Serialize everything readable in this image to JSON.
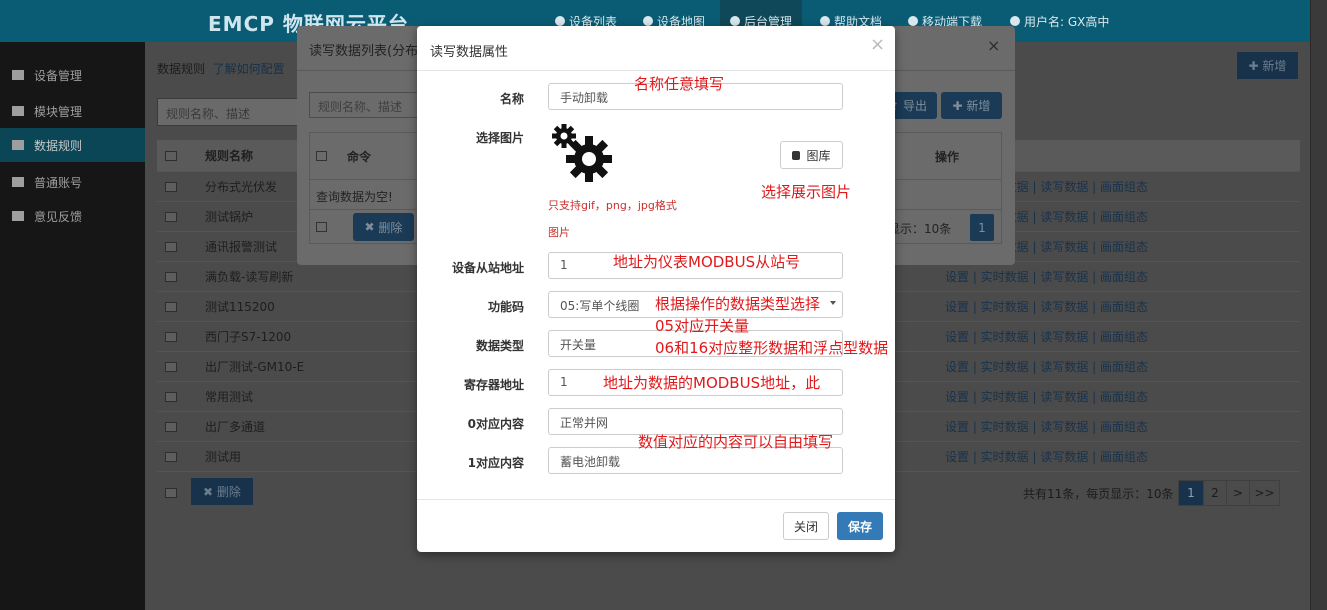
{
  "app": {
    "logo": "EMCP 物联网云平台"
  },
  "topnav": [
    {
      "label": "设备列表"
    },
    {
      "label": "设备地图"
    },
    {
      "label": "后台管理"
    },
    {
      "label": "帮助文档"
    },
    {
      "label": "移动端下载"
    },
    {
      "label": "用户名: GX高中"
    }
  ],
  "sidebar": {
    "items": [
      {
        "label": "设备管理"
      },
      {
        "label": "模块管理"
      },
      {
        "label": "数据规则"
      },
      {
        "label": "普通账号"
      },
      {
        "label": "意见反馈"
      }
    ]
  },
  "main": {
    "crumb_title": "数据规则",
    "crumb_link": "了解如何配置",
    "search_placeholder": "规则名称、描述",
    "new_button": "新增",
    "col_name": "规则名称",
    "rows": [
      {
        "name": "分布式光伏发"
      },
      {
        "name": "测试锅炉"
      },
      {
        "name": "通讯报警测试"
      },
      {
        "name": "满负载-读写刷新"
      },
      {
        "name": "测试115200"
      },
      {
        "name": "西门子S7-1200"
      },
      {
        "name": "出厂测试-GM10-E"
      },
      {
        "name": "常用测试"
      },
      {
        "name": "出厂多通道"
      },
      {
        "name": "测试用"
      }
    ],
    "ops": "设置 | 实时数据 | 读写数据 | 画面组态",
    "delete_button": "删除",
    "pagination_text": "共有11条，每页显示：10条",
    "pages": [
      "1",
      "2",
      ">",
      ">>"
    ]
  },
  "modal1": {
    "title": "读写数据列表(分布",
    "search_placeholder": "规则名称、描述",
    "export_button": "导出",
    "new_button": "新增",
    "col_command": "命令",
    "col_ops": "操作",
    "empty_text": "查询数据为空!",
    "delete_button": "删除",
    "pagination_text": "显示：10条",
    "page": "1"
  },
  "modal2": {
    "title": "读写数据属性",
    "fields": {
      "name_label": "名称",
      "name_value": "手动卸载",
      "image_label": "选择图片",
      "image_hint_line1": "只支持gif，png，jpg格式",
      "image_hint_line2": "图片",
      "gallery_button": "图库",
      "slave_label": "设备从站地址",
      "slave_value": "1",
      "func_label": "功能码",
      "func_value": "05:写单个线圈",
      "dtype_label": "数据类型",
      "dtype_value": "开关量",
      "reg_label": "寄存器地址",
      "reg_value": "1",
      "zero_label": "0对应内容",
      "zero_value": "正常并网",
      "one_label": "1对应内容",
      "one_value": "蓄电池卸载"
    },
    "close_button": "关闭",
    "save_button": "保存"
  },
  "annotations": {
    "name": "名称任意填写",
    "image": "选择展示图片",
    "slave": "地址为仪表MODBUS从站号",
    "func_line1": "根据操作的数据类型选择",
    "func_line2": "05对应开关量",
    "func_line3": "06和16对应整形数据和浮点型数据",
    "reg": "地址为数据的MODBUS地址，此",
    "content": "数值对应的内容可以自由填写"
  },
  "colors": {
    "primary": "#337ab7",
    "annotation": "#e0191a",
    "topbar": "#0a5c74"
  }
}
